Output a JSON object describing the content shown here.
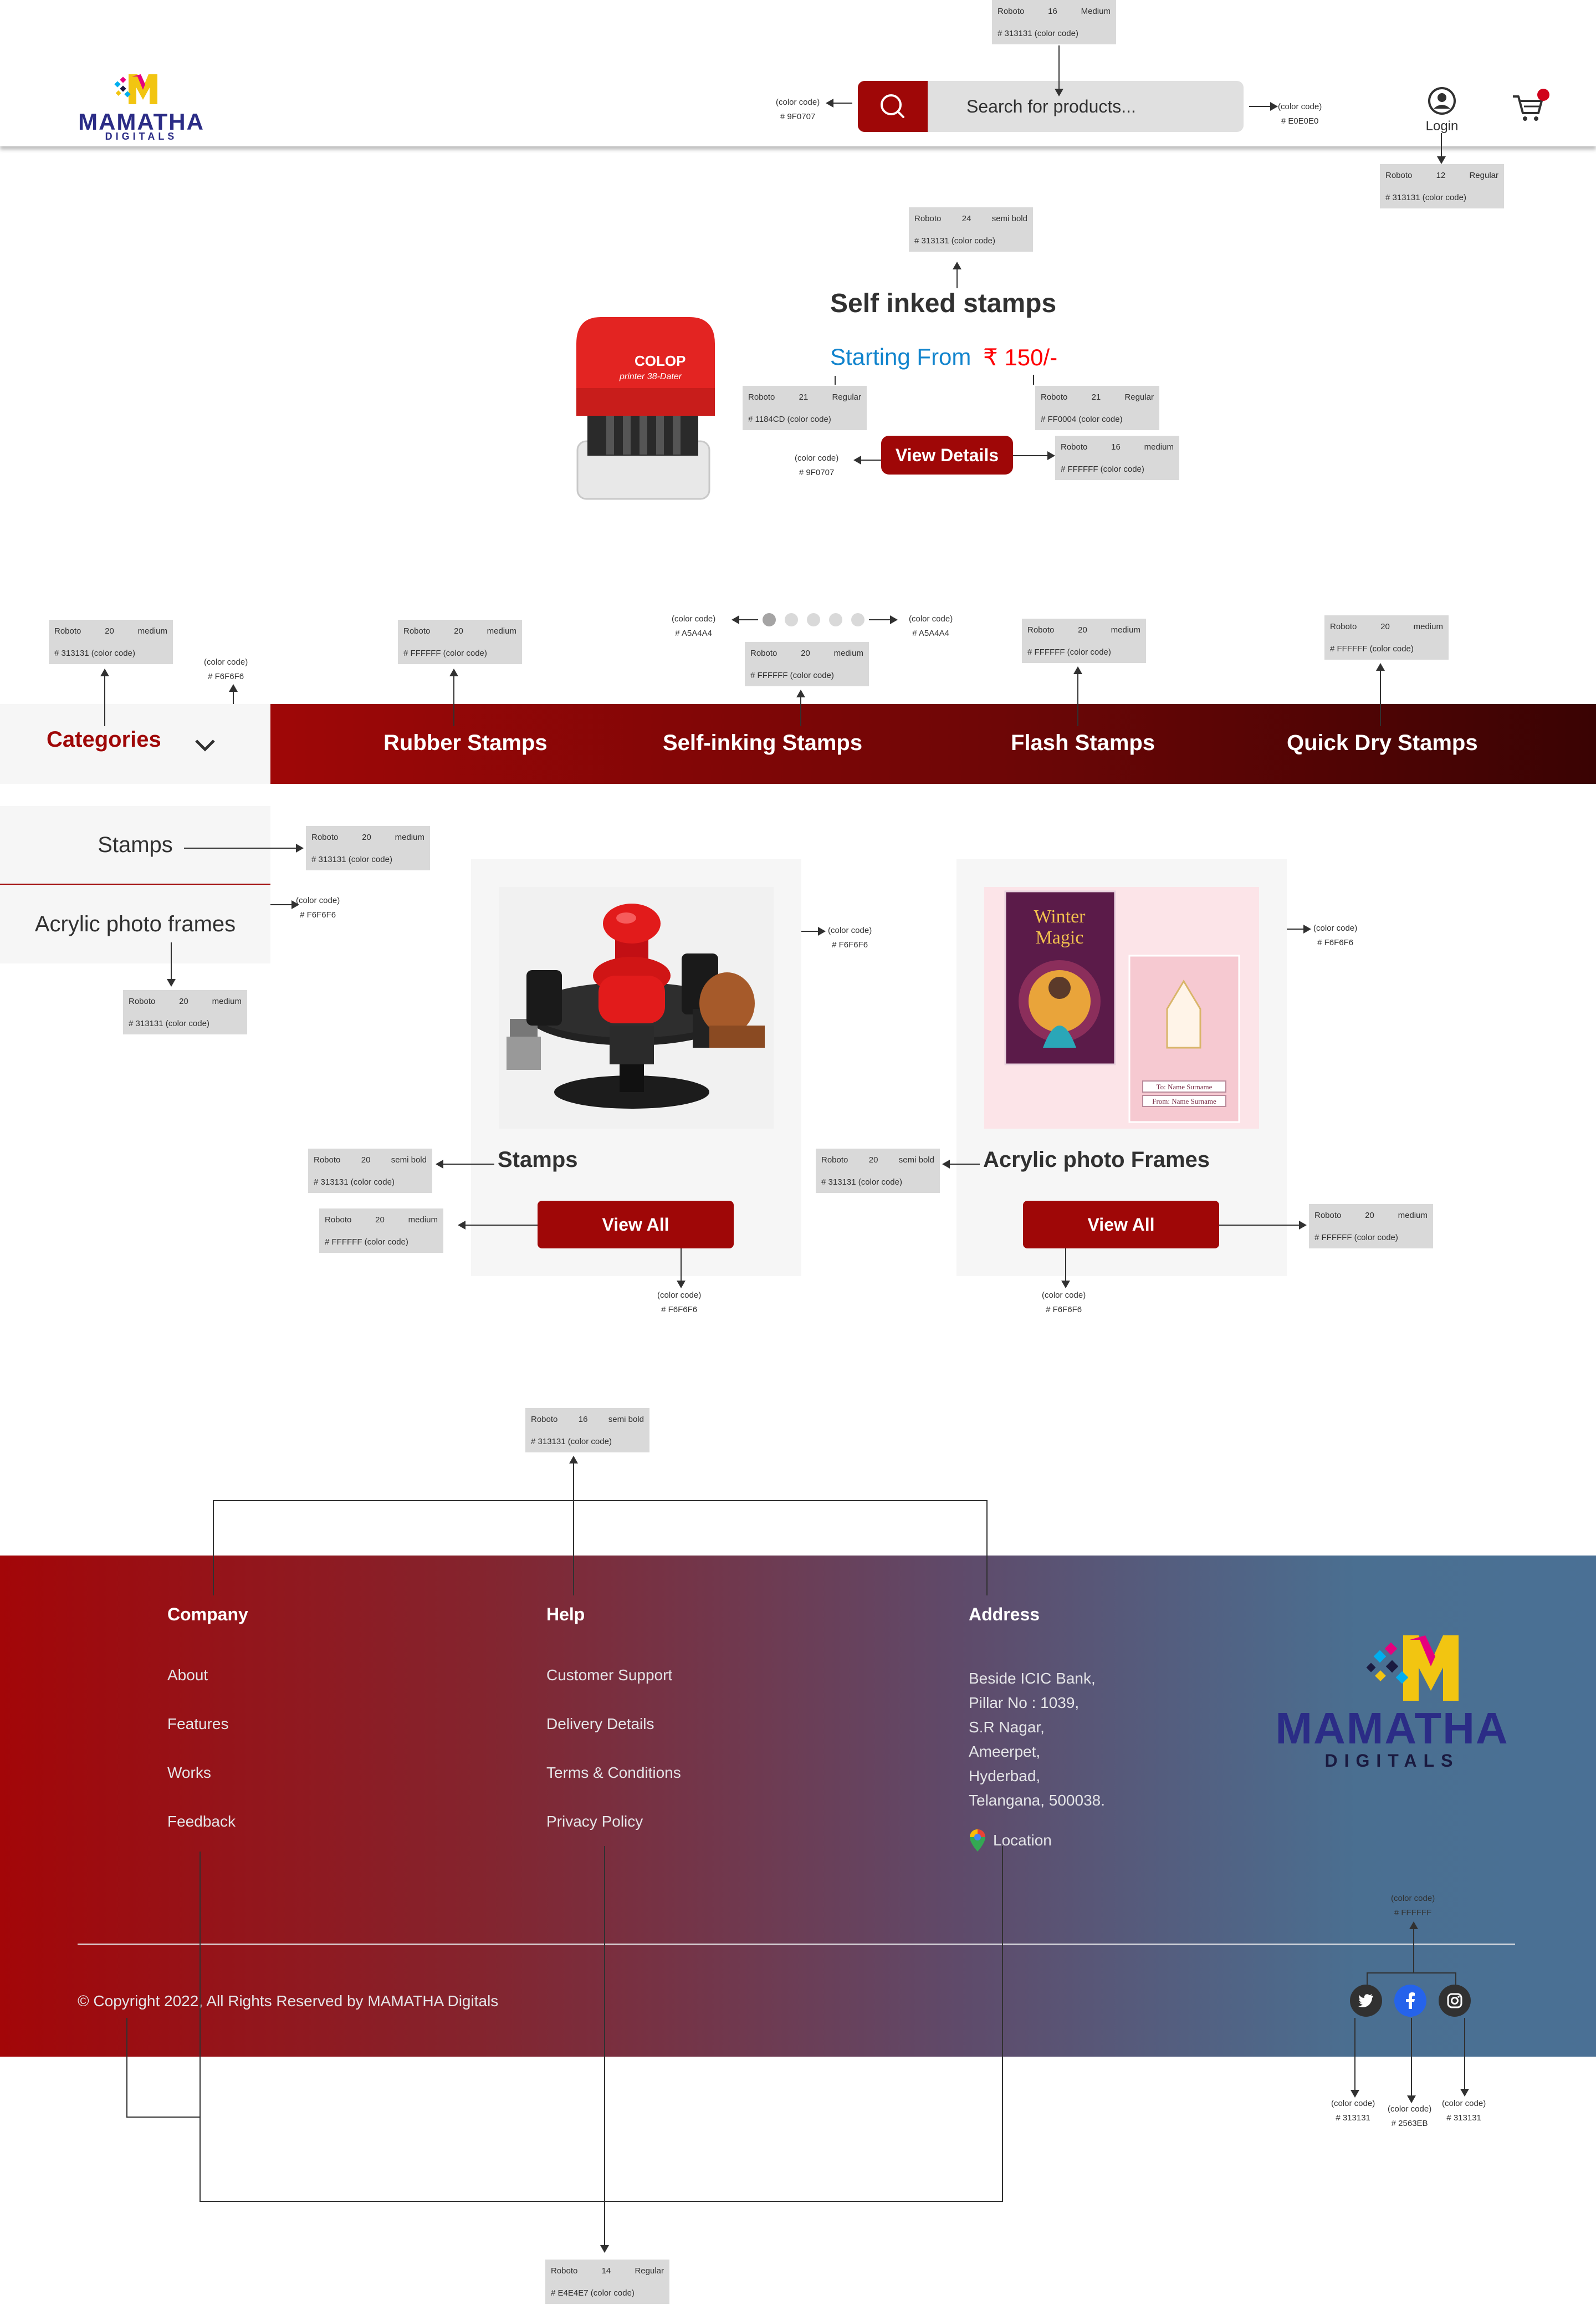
{
  "header": {
    "logo_text": "MAMATHA",
    "logo_sub": "DIGITALS",
    "search_placeholder": "Search for products...",
    "login_label": "Login",
    "colors": {
      "search_button": "#9F0707",
      "search_field": "#E0E0E0",
      "text": "#313131",
      "cart_badge": "#D0021B"
    }
  },
  "hero": {
    "title": "Self inked stamps",
    "starting_from": "Starting From",
    "price": "₹ 150/-",
    "button_label": "View Details",
    "product_brand": "COLOP",
    "product_model": "printer 38-Dater",
    "colors": {
      "starting_from": "#1184CD",
      "price": "#FF0004",
      "button": "#9F0707"
    }
  },
  "carousel": {
    "dot_count": 5,
    "active_index": 0
  },
  "categories_nav": {
    "label": "Categories",
    "items": [
      "Rubber Stamps",
      "Self-inking Stamps",
      "Flash Stamps",
      "Quick Dry Stamps"
    ],
    "colors": {
      "left_bg": "#F6F6F6",
      "label": "#9F0707"
    }
  },
  "side_menu": {
    "items": [
      "Stamps",
      "Acrylic photo frames"
    ]
  },
  "cards": [
    {
      "title": "Stamps",
      "button_label": "View All"
    },
    {
      "title": "Acrylic photo Frames",
      "button_label": "View All",
      "image_text_1": "Winter",
      "image_text_2": "Magic",
      "image_line_1": "To: Name Surname",
      "image_line_2": "From: Name Surname"
    }
  ],
  "footer": {
    "columns": [
      {
        "heading": "Company",
        "links": [
          "About",
          "Features",
          "Works",
          "Feedback"
        ]
      },
      {
        "heading": "Help",
        "links": [
          "Customer Support",
          "Delivery Details",
          "Terms & Conditions",
          "Privacy Policy"
        ]
      },
      {
        "heading": "Address",
        "lines": [
          "Beside ICIC Bank,",
          "Pillar No : 1039,",
          "S.R Nagar,",
          "Ameerpet,",
          "Hyderbad,",
          "Telangana, 500038."
        ],
        "location_label": "Location"
      }
    ],
    "copyright": "© Copyright 2022, All Rights Reserved by MAMATHA Digitals",
    "logo_text": "MAMATHA",
    "logo_sub": "DIGITALS",
    "social": [
      "twitter-icon",
      "facebook-icon",
      "instagram-icon"
    ],
    "colors": {
      "twitter": "#313131",
      "facebook": "#2563EB",
      "instagram": "#313131",
      "link": "#E4E4E7"
    }
  },
  "specs": {
    "s01": {
      "font": "Roboto",
      "size": "16",
      "weight": "Medium",
      "color": "# 313131",
      "note": "(color code)"
    },
    "s02": {
      "font": "Roboto",
      "size": "12",
      "weight": "Regular",
      "color": "# 313131",
      "note": "(color code)"
    },
    "s03": {
      "font": "Roboto",
      "size": "24",
      "weight": "semi bold",
      "color": "# 313131",
      "note": "(color code)"
    },
    "s04": {
      "font": "Roboto",
      "size": "21",
      "weight": "Regular",
      "color": "# 1184CD",
      "note": "(color code)"
    },
    "s05": {
      "font": "Roboto",
      "size": "21",
      "weight": "Regular",
      "color": "# FF0004",
      "note": "(color code)"
    },
    "s06": {
      "font": "Roboto",
      "size": "16",
      "weight": "medium",
      "color": "# FFFFFF",
      "note": "(color code)"
    },
    "s07": {
      "font": "Roboto",
      "size": "20",
      "weight": "medium",
      "color": "# 313131",
      "note": "(color code)"
    },
    "s08": {
      "font": "Roboto",
      "size": "20",
      "weight": "medium",
      "color": "# FFFFFF",
      "note": "(color code)"
    },
    "s09": {
      "font": "Roboto",
      "size": "20",
      "weight": "medium",
      "color": "# FFFFFF",
      "note": "(color code)"
    },
    "s10": {
      "font": "Roboto",
      "size": "20",
      "weight": "medium",
      "color": "# FFFFFF",
      "note": "(color code)"
    },
    "s11": {
      "font": "Roboto",
      "size": "20",
      "weight": "medium",
      "color": "# FFFFFF",
      "note": "(color code)"
    },
    "s12": {
      "font": "Roboto",
      "size": "20",
      "weight": "medium",
      "color": "# 313131",
      "note": "(color code)"
    },
    "s13": {
      "font": "Roboto",
      "size": "20",
      "weight": "medium",
      "color": "# 313131",
      "note": "(color code)"
    },
    "s14": {
      "font": "Roboto",
      "size": "20",
      "weight": "semi bold",
      "color": "# 313131",
      "note": "(color code)"
    },
    "s15": {
      "font": "Roboto",
      "size": "20",
      "weight": "medium",
      "color": "# FFFFFF",
      "note": "(color code)"
    },
    "s16": {
      "font": "Roboto",
      "size": "20",
      "weight": "semi bold",
      "color": "# 313131",
      "note": "(color code)"
    },
    "s17": {
      "font": "Roboto",
      "size": "20",
      "weight": "medium",
      "color": "# FFFFFF",
      "note": "(color code)"
    },
    "s18": {
      "font": "Roboto",
      "size": "16",
      "weight": "semi bold",
      "color": "# 313131",
      "note": "(color code)"
    },
    "s19": {
      "font": "Roboto",
      "size": "14",
      "weight": "Regular",
      "color": "# E4E4E7",
      "note": "(color code)"
    }
  },
  "color_notes": {
    "c01": {
      "label": "(color code)",
      "value": "# 9F0707"
    },
    "c02": {
      "label": "(color code)",
      "value": "# E0E0E0"
    },
    "c03": {
      "label": "(color code)",
      "value": "# 9F0707"
    },
    "c04": {
      "label": "(color code)",
      "value": "# A5A4A4"
    },
    "c05": {
      "label": "(color code)",
      "value": "# A5A4A4"
    },
    "c06": {
      "label": "(color code)",
      "value": "# F6F6F6"
    },
    "c07": {
      "label": "(color code)",
      "value": "# F6F6F6"
    },
    "c08": {
      "label": "(color code)",
      "value": "# F6F6F6"
    },
    "c09": {
      "label": "(color code)",
      "value": "# F6F6F6"
    },
    "c10": {
      "label": "(color code)",
      "value": "# F6F6F6"
    },
    "c11": {
      "label": "(color code)",
      "value": "# F6F6F6"
    },
    "c12": {
      "label": "(color code)",
      "value": "# FFFFFF"
    },
    "c13": {
      "label": "(color code)",
      "value": "# 313131"
    },
    "c14": {
      "label": "(color code)",
      "value": "# 2563EB"
    },
    "c15": {
      "label": "(color code)",
      "value": "# 313131"
    }
  }
}
